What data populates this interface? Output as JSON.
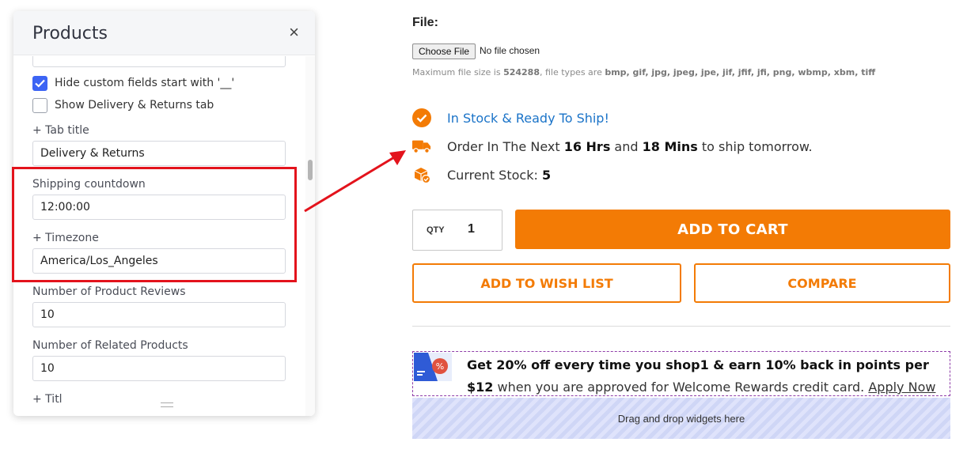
{
  "panel": {
    "title": "Products",
    "close_glyph": "×",
    "hide_custom_fields_label": "Hide custom fields start with '__'",
    "hide_custom_fields_checked": true,
    "show_delivery_label": "Show Delivery & Returns tab",
    "show_delivery_checked": false,
    "tab_title_label": "+ Tab title",
    "tab_title_value": "Delivery & Returns",
    "shipping_countdown_label": "Shipping countdown",
    "shipping_countdown_value": "12:00:00",
    "timezone_label": "+ Timezone",
    "timezone_value": "America/Los_Angeles",
    "reviews_label": "Number of Product Reviews",
    "reviews_value": "10",
    "related_label": "Number of Related Products",
    "related_value": "10",
    "partial_label": "+ Titl"
  },
  "product": {
    "file_label": "File:",
    "choose_file": "Choose File",
    "no_file": "No file chosen",
    "file_note_prefix": "Maximum file size is ",
    "file_note_size": "524288",
    "file_note_mid": ", file types are ",
    "file_note_types": "bmp, gif, jpg, jpeg, jpe, jif, jfif, jfi, png, wbmp, xbm, tiff",
    "in_stock": "In Stock & Ready To Ship!",
    "order_prefix": "Order In The Next ",
    "order_hours": "16 Hrs",
    "order_and": " and ",
    "order_mins": "18 Mins",
    "order_suffix": " to ship tomorrow.",
    "stock_label": "Current Stock: ",
    "stock_value": "5",
    "qty_label": "QTY",
    "qty_value": "1",
    "add_to_cart": "ADD TO CART",
    "add_to_wishlist": "ADD TO WISH LIST",
    "compare": "COMPARE",
    "promo_bold": "Get 20% off every time you shop1 & earn 10% back in points per $12",
    "promo_rest": " when you are approved for Welcome Rewards credit card. ",
    "promo_link": "Apply Now",
    "dropzone": "Drag and drop widgets here"
  },
  "colors": {
    "accent": "#f37b05",
    "link_blue": "#1a73c8",
    "highlight_red": "#e3131c",
    "checkbox_blue": "#3c64f4"
  },
  "icons": [
    "close-icon",
    "check-icon",
    "check-circle-icon",
    "truck-icon",
    "box-icon",
    "credit-card-icon",
    "drag-handle-icon"
  ]
}
